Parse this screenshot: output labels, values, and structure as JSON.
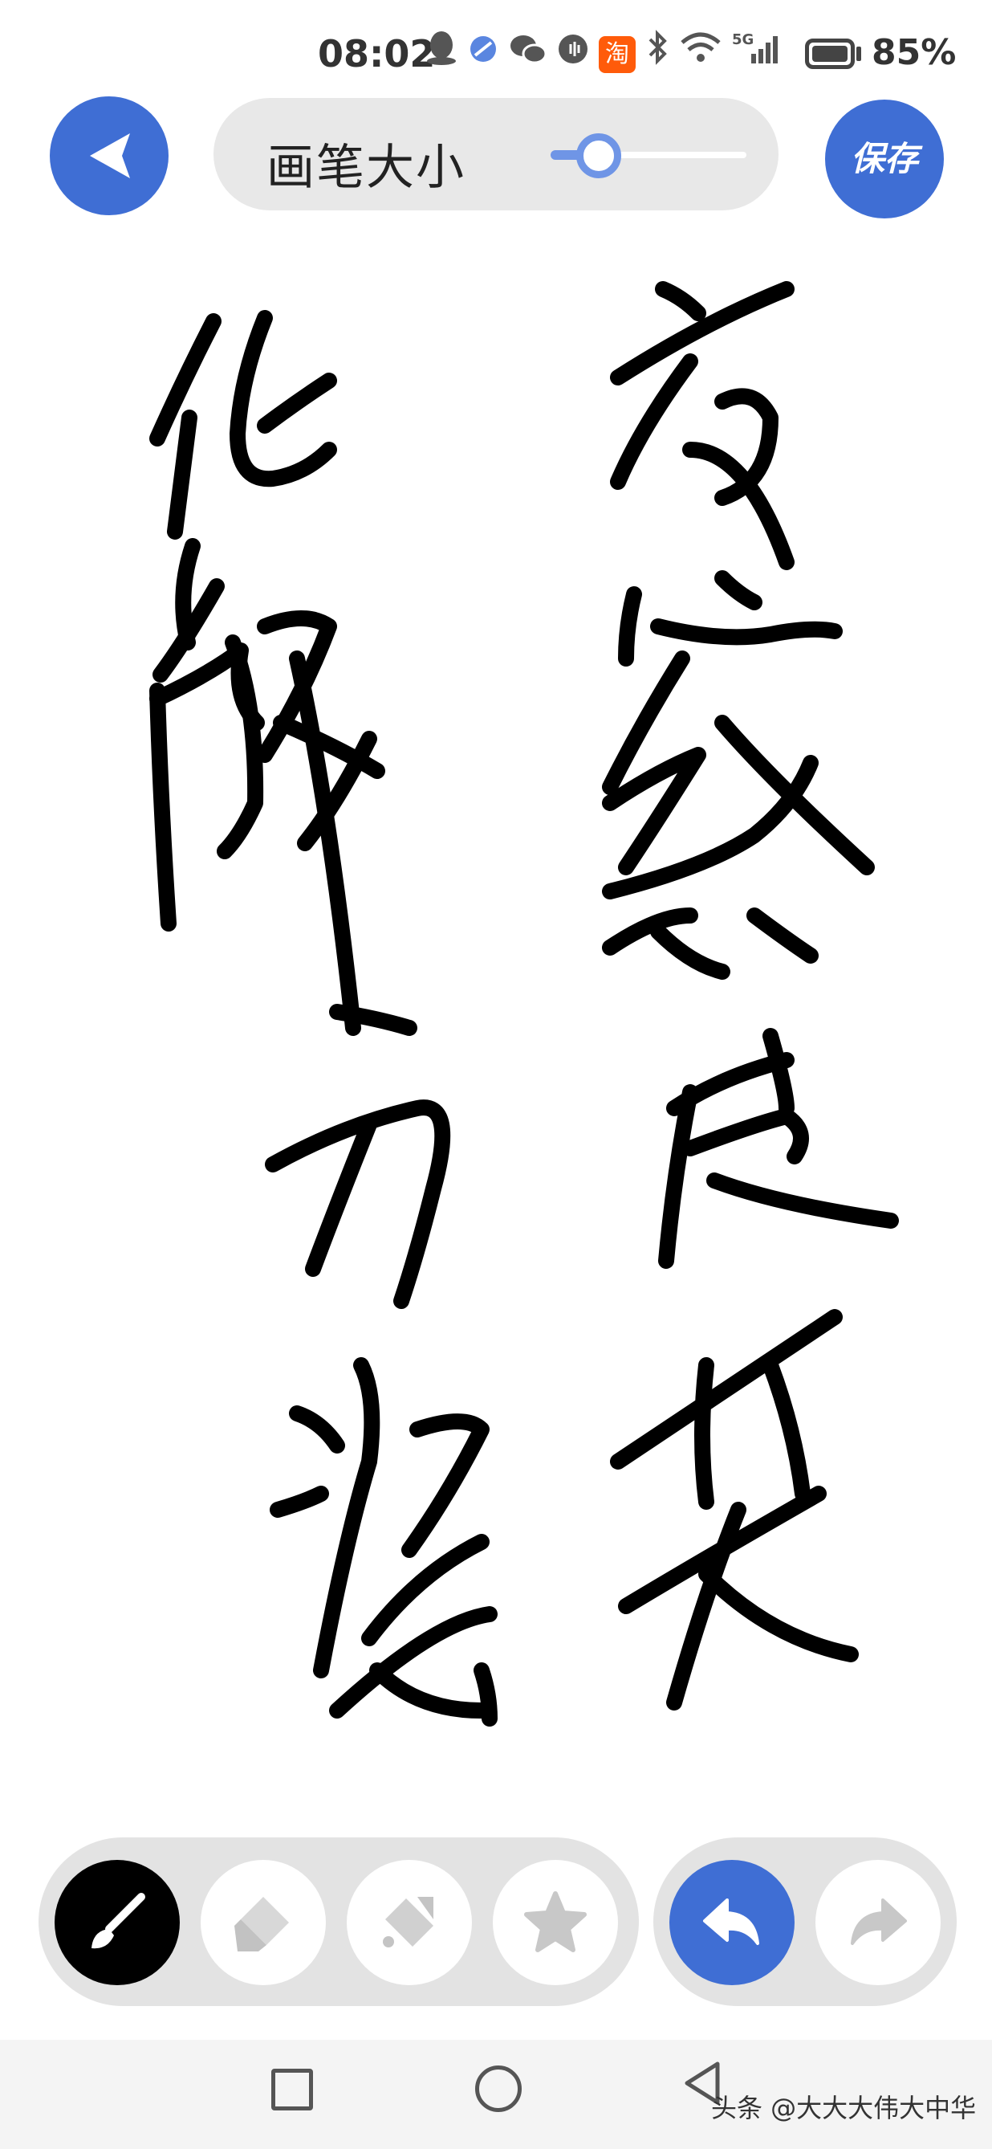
{
  "status_bar": {
    "time": "08:02",
    "network": "5G",
    "battery": "85%",
    "battery_level": 0.85,
    "icons": [
      "qq-icon",
      "app-icon",
      "wechat-icon",
      "audio-icon",
      "taobao-icon",
      "bluetooth-icon",
      "wifi-icon",
      "signal-icon",
      "battery-icon"
    ],
    "taobao_label": "淘"
  },
  "toolbar_top": {
    "brush_size_label": "画笔大小",
    "brush_size_level": 0.15,
    "save_label": "保存",
    "accent_color": "#3f6ed4",
    "slider_color": "#6f95e6"
  },
  "bottom_tools": {
    "tools": [
      "brush-icon",
      "eraser-icon",
      "fill-bucket-icon",
      "star-icon"
    ],
    "active_tool": "brush",
    "history": [
      "undo-icon",
      "redo-icon"
    ]
  },
  "nav_bar": {
    "watermark": "头条 @大大大伟大中华"
  }
}
